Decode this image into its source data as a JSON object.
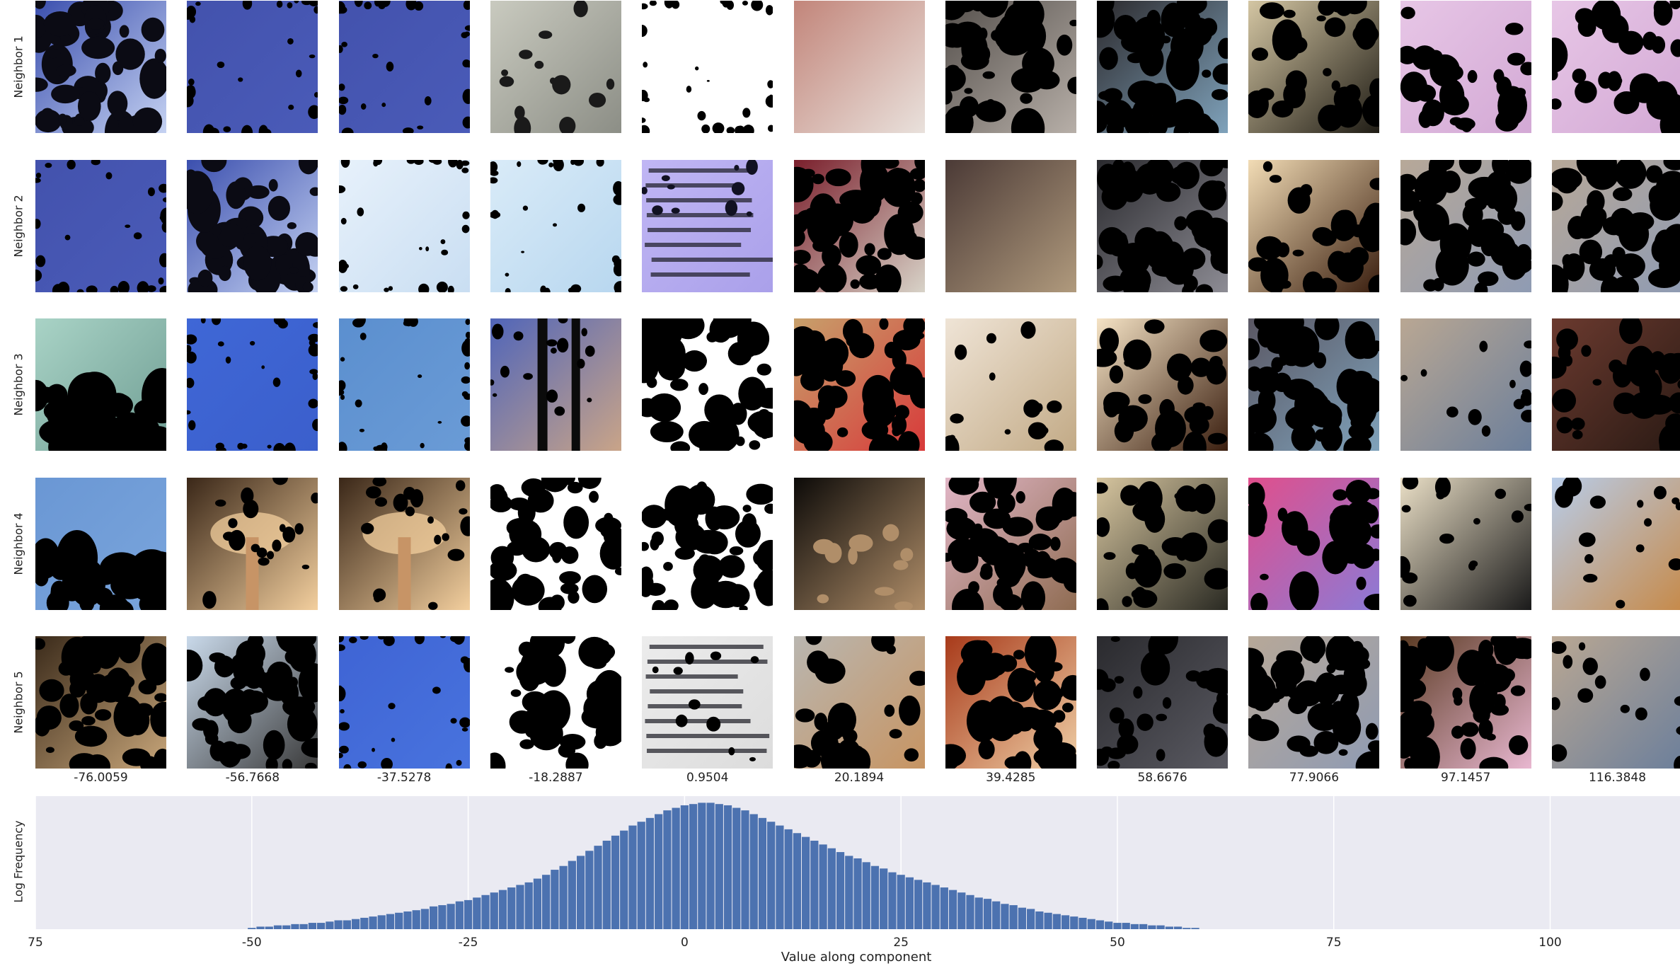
{
  "chart_data": {
    "type": "image-grid-with-histogram",
    "row_labels": [
      "Neighbor 1",
      "Neighbor 2",
      "Neighbor 3",
      "Neighbor 4",
      "Neighbor 5"
    ],
    "column_values": [
      "-76.0059",
      "-56.7668",
      "-37.5278",
      "-18.2887",
      "0.9504",
      "20.1894",
      "39.4285",
      "58.6676",
      "77.9066",
      "97.1457",
      "116.3848"
    ],
    "thumbnails": [
      [
        {
          "bg": "#3b4fae",
          "bg2": "#c5d2f2",
          "mask": "heavy",
          "dark": "#0b0b14"
        },
        {
          "bg": "#4352ad",
          "bg2": "#4a5bb8",
          "mask": "edge",
          "dark": "#000000"
        },
        {
          "bg": "#4352ad",
          "bg2": "#4a5bb8",
          "mask": "edge",
          "dark": "#000000"
        },
        {
          "bg": "#c9cabf",
          "bg2": "#8c8e86",
          "mask": "light",
          "dark": "#1a1a1a"
        },
        {
          "bg": "#ffffff",
          "bg2": "#ffffff",
          "mask": "edge",
          "dark": "#000000"
        },
        {
          "bg": "#c2857a",
          "bg2": "#e9e1dc",
          "mask": "none",
          "dark": "#111111"
        },
        {
          "bg": "#55504c",
          "bg2": "#b7afa8",
          "mask": "heavy",
          "dark": "#000000"
        },
        {
          "bg": "#2c2a2d",
          "bg2": "#7fa2bb",
          "mask": "heavy",
          "dark": "#000000"
        },
        {
          "bg": "#d4c6a3",
          "bg2": "#1f1c15",
          "mask": "medium",
          "dark": "#000000"
        },
        {
          "bg": "#e7c6e6",
          "bg2": "#d3a9d5",
          "mask": "medium",
          "dark": "#000000"
        },
        {
          "bg": "#e7c6e6",
          "bg2": "#d3a9d5",
          "mask": "medium",
          "dark": "#000000"
        }
      ],
      [
        {
          "bg": "#4352ad",
          "bg2": "#4a5bb8",
          "mask": "edge",
          "dark": "#000000"
        },
        {
          "bg": "#3b4fae",
          "bg2": "#c5d2f2",
          "mask": "heavy",
          "dark": "#0b0b14"
        },
        {
          "bg": "#e7f1fb",
          "bg2": "#c9def2",
          "mask": "edge",
          "dark": "#000000"
        },
        {
          "bg": "#d9ebf8",
          "bg2": "#b8d7ef",
          "mask": "edge",
          "dark": "#000000"
        },
        {
          "bg": "#c0b6f4",
          "bg2": "#aaa0ea",
          "mask": "text",
          "dark": "#111122"
        },
        {
          "bg": "#7a1f2c",
          "bg2": "#d8d3c8",
          "mask": "heavy",
          "dark": "#000000"
        },
        {
          "bg": "#4b3a36",
          "bg2": "#b09a7d",
          "mask": "none",
          "dark": "#1a1414"
        },
        {
          "bg": "#2a2a2e",
          "bg2": "#8d8c94",
          "mask": "heavy",
          "dark": "#000000"
        },
        {
          "bg": "#f2dcb5",
          "bg2": "#3a1e0f",
          "mask": "medium",
          "dark": "#000000"
        },
        {
          "bg": "#b7a898",
          "bg2": "#8f9bb3",
          "mask": "heavy",
          "dark": "#000000"
        },
        {
          "bg": "#b7a898",
          "bg2": "#8f9bb3",
          "mask": "heavy",
          "dark": "#000000"
        }
      ],
      [
        {
          "bg": "#a9d3c6",
          "bg2": "#6f9d93",
          "mask": "bottom",
          "dark": "#000000"
        },
        {
          "bg": "#3f67d6",
          "bg2": "#3b5fcc",
          "mask": "edge",
          "dark": "#000000"
        },
        {
          "bg": "#5b8fcf",
          "bg2": "#6a9bd6",
          "mask": "edge",
          "dark": "#000000"
        },
        {
          "bg": "#5065b9",
          "bg2": "#c9a488",
          "mask": "stripes",
          "dark": "#000000"
        },
        {
          "bg": "#ffffff",
          "bg2": "#ffffff",
          "mask": "heavy",
          "dark": "#000000"
        },
        {
          "bg": "#c7a06b",
          "bg2": "#d83a3a",
          "mask": "heavy",
          "dark": "#000000"
        },
        {
          "bg": "#efe4d6",
          "bg2": "#c2aa86",
          "mask": "light",
          "dark": "#000000"
        },
        {
          "bg": "#f5e3c5",
          "bg2": "#3a1e0f",
          "mask": "medium",
          "dark": "#000000"
        },
        {
          "bg": "#5a5763",
          "bg2": "#7fa2bb",
          "mask": "heavy",
          "dark": "#000000"
        },
        {
          "bg": "#b9a793",
          "bg2": "#6c7f9b",
          "mask": "light",
          "dark": "#000000"
        },
        {
          "bg": "#6b3a2f",
          "bg2": "#2a1a14",
          "mask": "medium",
          "dark": "#000000"
        }
      ],
      [
        {
          "bg": "#6a97d4",
          "bg2": "#7aa5dc",
          "mask": "bottom",
          "dark": "#000000"
        },
        {
          "bg": "#3a2718",
          "bg2": "#f3cf9e",
          "mask": "glow",
          "dark": "#000000"
        },
        {
          "bg": "#3a2718",
          "bg2": "#f3cf9e",
          "mask": "glow",
          "dark": "#000000"
        },
        {
          "bg": "#ffffff",
          "bg2": "#ffffff",
          "mask": "heavy",
          "dark": "#000000"
        },
        {
          "bg": "#ffffff",
          "bg2": "#ffffff",
          "mask": "heavy",
          "dark": "#000000"
        },
        {
          "bg": "#0c0a08",
          "bg2": "#b08e69",
          "mask": "dark",
          "dark": "#000000"
        },
        {
          "bg": "#e1b6c6",
          "bg2": "#8f6c52",
          "mask": "heavy",
          "dark": "#000000"
        },
        {
          "bg": "#d6c59f",
          "bg2": "#2a2a23",
          "mask": "medium",
          "dark": "#000000"
        },
        {
          "bg": "#e04f8c",
          "bg2": "#8c7ad6",
          "mask": "medium",
          "dark": "#000000"
        },
        {
          "bg": "#eadfc6",
          "bg2": "#1a1a1a",
          "mask": "light",
          "dark": "#000000"
        },
        {
          "bg": "#b8cce8",
          "bg2": "#c68a4a",
          "mask": "light",
          "dark": "#000000"
        }
      ],
      [
        {
          "bg": "#3a2a1a",
          "bg2": "#c8a67a",
          "mask": "heavy",
          "dark": "#000000"
        },
        {
          "bg": "#c9d9ea",
          "bg2": "#3a3a3a",
          "mask": "heavy",
          "dark": "#000000"
        },
        {
          "bg": "#3f64d4",
          "bg2": "#4873de",
          "mask": "edge",
          "dark": "#000000"
        },
        {
          "bg": "#ffffff",
          "bg2": "#ffffff",
          "mask": "heavy",
          "dark": "#000000"
        },
        {
          "bg": "#ececec",
          "bg2": "#dcdcdc",
          "mask": "text",
          "dark": "#000000"
        },
        {
          "bg": "#b9b6b0",
          "bg2": "#c79462",
          "mask": "medium",
          "dark": "#000000"
        },
        {
          "bg": "#a83a1a",
          "bg2": "#efcfa6",
          "mask": "heavy",
          "dark": "#000000"
        },
        {
          "bg": "#2a2a2e",
          "bg2": "#5a5a62",
          "mask": "medium",
          "dark": "#000000"
        },
        {
          "bg": "#b7a898",
          "bg2": "#8f9bb3",
          "mask": "heavy",
          "dark": "#000000"
        },
        {
          "bg": "#5a3a22",
          "bg2": "#e8b7d0",
          "mask": "heavy",
          "dark": "#000000"
        },
        {
          "bg": "#b9a793",
          "bg2": "#6c7f9b",
          "mask": "light",
          "dark": "#000000"
        }
      ]
    ],
    "histogram": {
      "xlabel": "Value along component",
      "ylabel": "Log Frequency",
      "xlim": [
        -75,
        115
      ],
      "xticks": [
        -75,
        -50,
        -25,
        0,
        25,
        50,
        75,
        100
      ],
      "xtick_labels": [
        "75",
        "-50",
        "-25",
        "0",
        "25",
        "50",
        "75",
        "100"
      ],
      "bar_color": "#4c72b0",
      "background": "#eaeaf2",
      "grid": true,
      "bin_start": -50.5,
      "bin_width": 1,
      "counts": [
        1,
        2,
        2,
        3,
        3,
        4,
        4,
        5,
        5,
        6,
        7,
        7,
        8,
        9,
        10,
        11,
        12,
        13,
        14,
        15,
        16,
        18,
        19,
        20,
        22,
        23,
        25,
        27,
        29,
        31,
        33,
        35,
        37,
        40,
        43,
        47,
        50,
        54,
        58,
        62,
        66,
        70,
        74,
        78,
        82,
        85,
        88,
        91,
        94,
        96,
        98,
        99,
        100,
        100,
        99,
        98,
        96,
        94,
        91,
        88,
        85,
        82,
        79,
        76,
        73,
        70,
        67,
        64,
        61,
        58,
        56,
        53,
        50,
        48,
        45,
        43,
        41,
        39,
        37,
        35,
        33,
        31,
        29,
        27,
        25,
        24,
        22,
        20,
        19,
        17,
        16,
        14,
        13,
        12,
        11,
        10,
        9,
        8,
        7,
        6,
        5,
        5,
        4,
        4,
        3,
        3,
        2,
        2,
        1,
        1
      ]
    }
  }
}
